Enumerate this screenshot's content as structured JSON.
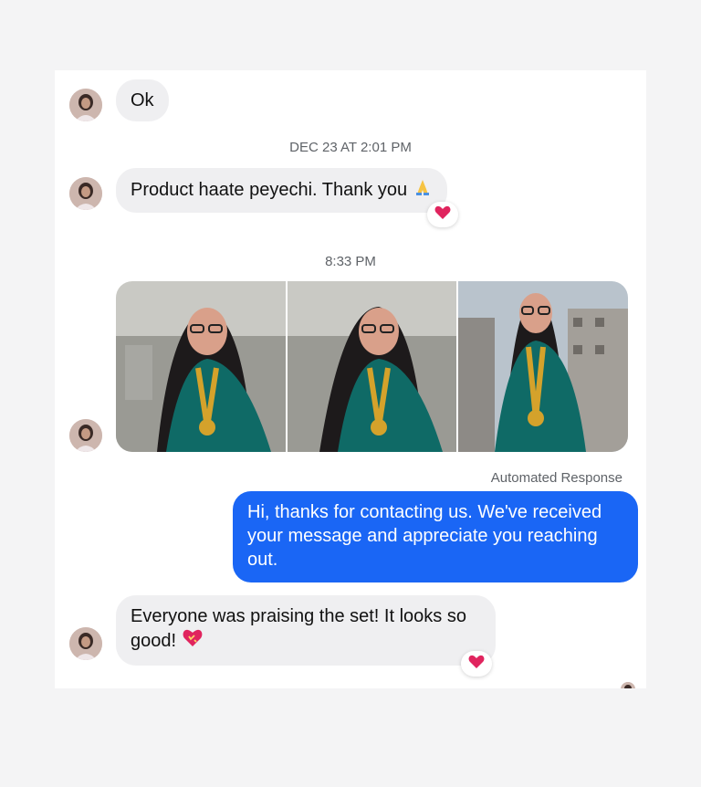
{
  "messages": [
    {
      "text": "Ok"
    },
    {
      "timestamp": "DEC 23 AT 2:01 PM"
    },
    {
      "text": "Product haate peyechi. Thank you",
      "emoji": "folded-hands-icon",
      "reaction": "heart-icon"
    },
    {
      "timestamp": "8:33 PM"
    },
    {
      "photos": 3
    },
    {
      "label": "Automated Response"
    },
    {
      "text": "Hi, thanks for contacting us. We've received your message and appreciate you reaching out."
    },
    {
      "text": "Everyone was praising the set! It looks so good!",
      "emoji": "sparkling-heart-icon",
      "reaction": "heart-icon"
    }
  ],
  "colors": {
    "outgoing_bubble": "#1a66f5",
    "incoming_bubble": "#efeff1",
    "reaction_heart": "#e0245e"
  }
}
